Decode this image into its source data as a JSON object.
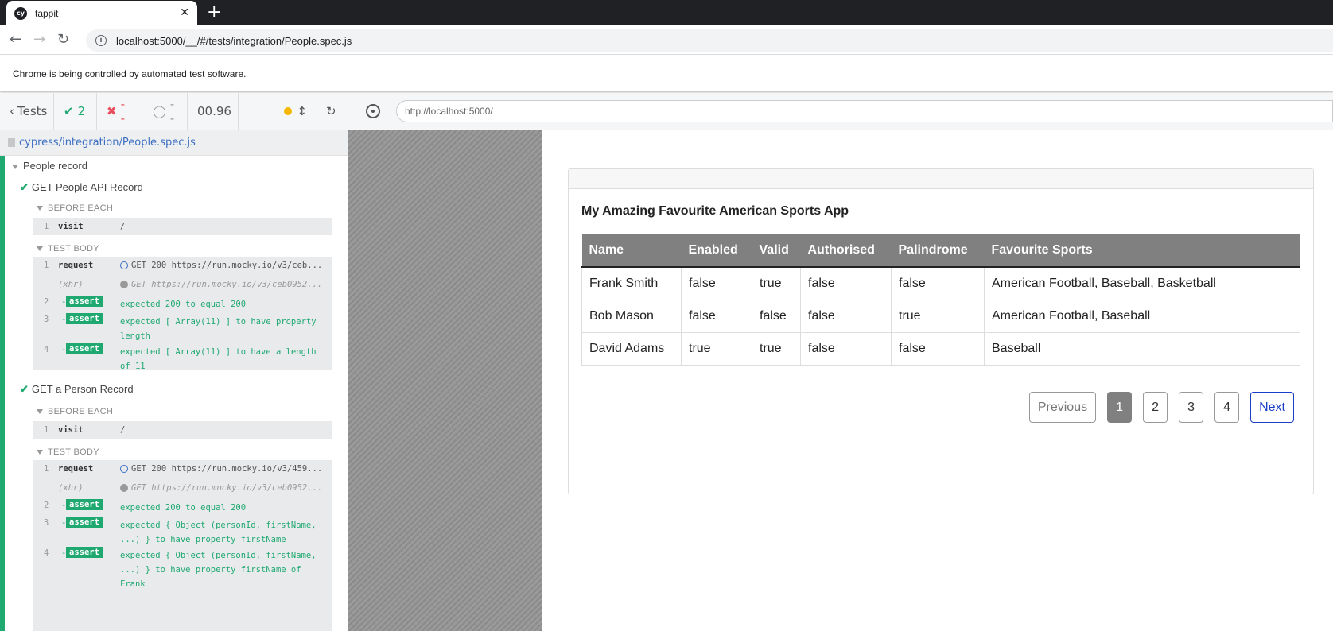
{
  "browser": {
    "tab_title": "tappit",
    "tab_icon": "cy",
    "address": "localhost:5000/__/#/tests/integration/People.spec.js",
    "infobar": "Chrome is being controlled by automated test software."
  },
  "reporter": {
    "tests_label": "Tests",
    "passed": "2",
    "failed": "--",
    "pending": "--",
    "duration": "00.96",
    "spec_path": "cypress/integration/People.spec.js",
    "suite": "People record",
    "test1": {
      "title": "GET People API Record",
      "before_each": "BEFORE EACH",
      "visit": {
        "n": "1",
        "name": "visit",
        "msg": "/"
      },
      "test_body": "TEST BODY",
      "request": {
        "n": "1",
        "name": "request",
        "msg": "GET 200 https://run.mocky.io/v3/ceb..."
      },
      "xhr": {
        "name": "(xhr)",
        "msg": "GET https://run.mocky.io/v3/ceb0952..."
      },
      "asserts": [
        {
          "n": "2",
          "label": "assert",
          "msg": "expected 200 to equal 200"
        },
        {
          "n": "3",
          "label": "assert",
          "msg": "expected [ Array(11) ] to have property length"
        },
        {
          "n": "4",
          "label": "assert",
          "msg": "expected [ Array(11) ] to have a length of 11"
        }
      ]
    },
    "test2": {
      "title": "GET a Person Record",
      "before_each": "BEFORE EACH",
      "visit": {
        "n": "1",
        "name": "visit",
        "msg": "/"
      },
      "test_body": "TEST BODY",
      "request": {
        "n": "1",
        "name": "request",
        "msg": "GET 200 https://run.mocky.io/v3/459..."
      },
      "xhr": {
        "name": "(xhr)",
        "msg": "GET https://run.mocky.io/v3/ceb0952..."
      },
      "asserts": [
        {
          "n": "2",
          "label": "assert",
          "msg": "expected 200 to equal 200"
        },
        {
          "n": "3",
          "label": "assert",
          "msg": "expected { Object (personId, firstName, ...) } to have property firstName"
        },
        {
          "n": "4",
          "label": "assert",
          "msg": "expected { Object (personId, firstName, ...) } to have property firstName of Frank"
        }
      ]
    }
  },
  "runner": {
    "url": "http://localhost:5000/"
  },
  "app": {
    "title": "My Amazing Favourite American Sports App",
    "columns": [
      "Name",
      "Enabled",
      "Valid",
      "Authorised",
      "Palindrome",
      "Favourite Sports"
    ],
    "rows": [
      [
        "Frank Smith",
        "false",
        "true",
        "false",
        "false",
        "American Football, Baseball, Basketball"
      ],
      [
        "Bob Mason",
        "false",
        "false",
        "false",
        "true",
        "American Football, Baseball"
      ],
      [
        "David Adams",
        "true",
        "true",
        "false",
        "false",
        "Baseball"
      ]
    ],
    "pager": {
      "previous": "Previous",
      "pages": [
        "1",
        "2",
        "3",
        "4"
      ],
      "active": "1",
      "next": "Next"
    }
  },
  "colors": {
    "pass": "#1fa971",
    "fail": "#e94f5f",
    "link": "#3d6fc3",
    "header_bg": "#808080"
  }
}
